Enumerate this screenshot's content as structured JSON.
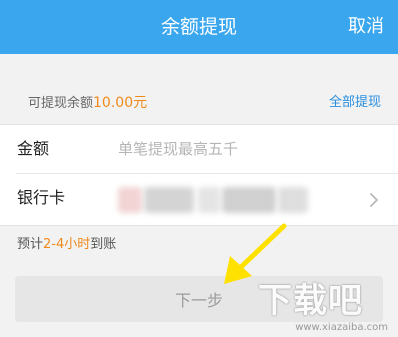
{
  "header": {
    "title": "余额提现",
    "cancel_label": "取消"
  },
  "balance": {
    "label": "可提现余额",
    "amount": "10.00元",
    "withdraw_all_label": "全部提现"
  },
  "form": {
    "amount_label": "金额",
    "amount_value": "",
    "amount_placeholder": "单笔提现最高五千",
    "bank_label": "银行卡"
  },
  "eta": {
    "prefix": "预计",
    "highlight": "2-4小时",
    "suffix": "到账"
  },
  "next_button_label": "下一步",
  "watermark": {
    "text": "下载吧",
    "url": "www.xiazaiba.com"
  },
  "colors": {
    "header_bg": "#3aa6ee",
    "accent_orange": "#f08a1b",
    "link_blue": "#2b8fe0",
    "arrow_yellow": "#ffe100"
  },
  "icons": {
    "bank_chevron": "chevron-right-icon"
  }
}
